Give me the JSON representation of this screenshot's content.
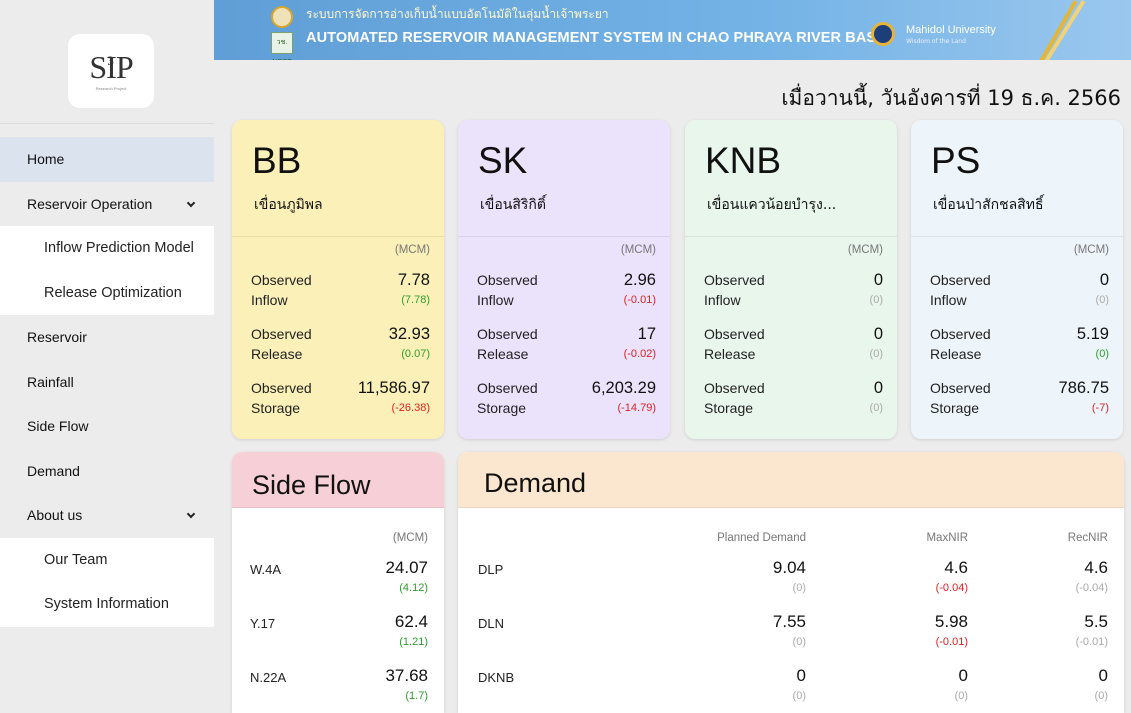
{
  "logo": {
    "main": "SIP",
    "superscript": "3",
    "sub": "Research Project"
  },
  "banner": {
    "title_th": "ระบบการจัดการอ่างเก็บน้ำแบบอัตโนมัติในลุ่มน้ำเจ้าพระยา",
    "title_en": "AUTOMATED RESERVOIR MANAGEMENT SYSTEM IN CHAO PHRAYA RIVER BASIN",
    "org_name": "Mahidol University",
    "org_sub": "Wisdom of the Land",
    "nrct": "วช.\nNRCT"
  },
  "date_text": "เมื่อวานนี้, วันอังคารที่ 19 ธ.ค. 2566",
  "nav": [
    {
      "label": "Home",
      "active": true,
      "sub": false
    },
    {
      "label": "Reservoir Operation",
      "active": false,
      "sub": false,
      "expandable": true
    },
    {
      "label": "Inflow Prediction Model",
      "active": false,
      "sub": true
    },
    {
      "label": "Release Optimization",
      "active": false,
      "sub": true
    },
    {
      "label": "Reservoir",
      "active": false,
      "sub": false
    },
    {
      "label": "Rainfall",
      "active": false,
      "sub": false
    },
    {
      "label": "Side Flow",
      "active": false,
      "sub": false
    },
    {
      "label": "Demand",
      "active": false,
      "sub": false
    },
    {
      "label": "About us",
      "active": false,
      "sub": false,
      "expandable": true
    },
    {
      "label": "Our Team",
      "active": false,
      "sub": true
    },
    {
      "label": "System Information",
      "active": false,
      "sub": true
    }
  ],
  "reservoirs": [
    {
      "code": "BB",
      "name": "เขื่อนภูมิพล",
      "unit": "(MCM)",
      "color": "#fbf1b8",
      "metrics": [
        {
          "label": "Observed Inflow",
          "value": "7.78",
          "diff": "(7.78)",
          "sign": "pos"
        },
        {
          "label": "Observed Release",
          "value": "32.93",
          "diff": "(0.07)",
          "sign": "pos"
        },
        {
          "label": "Observed Storage",
          "value": "11,586.97",
          "diff": "(-26.38)",
          "sign": "neg"
        }
      ]
    },
    {
      "code": "SK",
      "name": "เขื่อนสิริกิติ์",
      "unit": "(MCM)",
      "color": "#ebe2fb",
      "metrics": [
        {
          "label": "Observed Inflow",
          "value": "2.96",
          "diff": "(-0.01)",
          "sign": "neg"
        },
        {
          "label": "Observed Release",
          "value": "17",
          "diff": "(-0.02)",
          "sign": "neg"
        },
        {
          "label": "Observed Storage",
          "value": "6,203.29",
          "diff": "(-14.79)",
          "sign": "neg"
        }
      ]
    },
    {
      "code": "KNB",
      "name": "เขื่อนแควน้อยบำรุง...",
      "unit": "(MCM)",
      "color": "#e9f6ec",
      "metrics": [
        {
          "label": "Observed Inflow",
          "value": "0",
          "diff": "(0)",
          "sign": "zero"
        },
        {
          "label": "Observed Release",
          "value": "0",
          "diff": "(0)",
          "sign": "zero"
        },
        {
          "label": "Observed Storage",
          "value": "0",
          "diff": "(0)",
          "sign": "zero"
        }
      ]
    },
    {
      "code": "PS",
      "name": "เขื่อนป่าสักชลสิทธิ์",
      "unit": "(MCM)",
      "color": "#edf5fb",
      "metrics": [
        {
          "label": "Observed Inflow",
          "value": "0",
          "diff": "(0)",
          "sign": "zero"
        },
        {
          "label": "Observed Release",
          "value": "5.19",
          "diff": "(0)",
          "sign": "pos"
        },
        {
          "label": "Observed Storage",
          "value": "786.75",
          "diff": "(-7)",
          "sign": "neg"
        }
      ]
    }
  ],
  "side_flow": {
    "title": "Side Flow",
    "unit": "(MCM)",
    "rows": [
      {
        "name": "W.4A",
        "value": "24.07",
        "diff": "(4.12)",
        "sign": "pos"
      },
      {
        "name": "Y.17",
        "value": "62.4",
        "diff": "(1.21)",
        "sign": "pos"
      },
      {
        "name": "N.22A",
        "value": "37.68",
        "diff": "(1.7)",
        "sign": "pos"
      }
    ]
  },
  "demand": {
    "title": "Demand",
    "columns": [
      "Planned Demand",
      "MaxNIR",
      "RecNIR"
    ],
    "rows": [
      {
        "name": "DLP",
        "values": [
          {
            "value": "9.04",
            "diff": "(0)",
            "sign": "zero"
          },
          {
            "value": "4.6",
            "diff": "(-0.04)",
            "sign": "neg"
          },
          {
            "value": "4.6",
            "diff": "(-0.04)",
            "sign": "zero"
          }
        ]
      },
      {
        "name": "DLN",
        "values": [
          {
            "value": "7.55",
            "diff": "(0)",
            "sign": "zero"
          },
          {
            "value": "5.98",
            "diff": "(-0.01)",
            "sign": "neg"
          },
          {
            "value": "5.5",
            "diff": "(-0.01)",
            "sign": "zero"
          }
        ]
      },
      {
        "name": "DKNB",
        "values": [
          {
            "value": "0",
            "diff": "(0)",
            "sign": "zero"
          },
          {
            "value": "0",
            "diff": "(0)",
            "sign": "zero"
          },
          {
            "value": "0",
            "diff": "(0)",
            "sign": "zero"
          }
        ]
      }
    ]
  }
}
